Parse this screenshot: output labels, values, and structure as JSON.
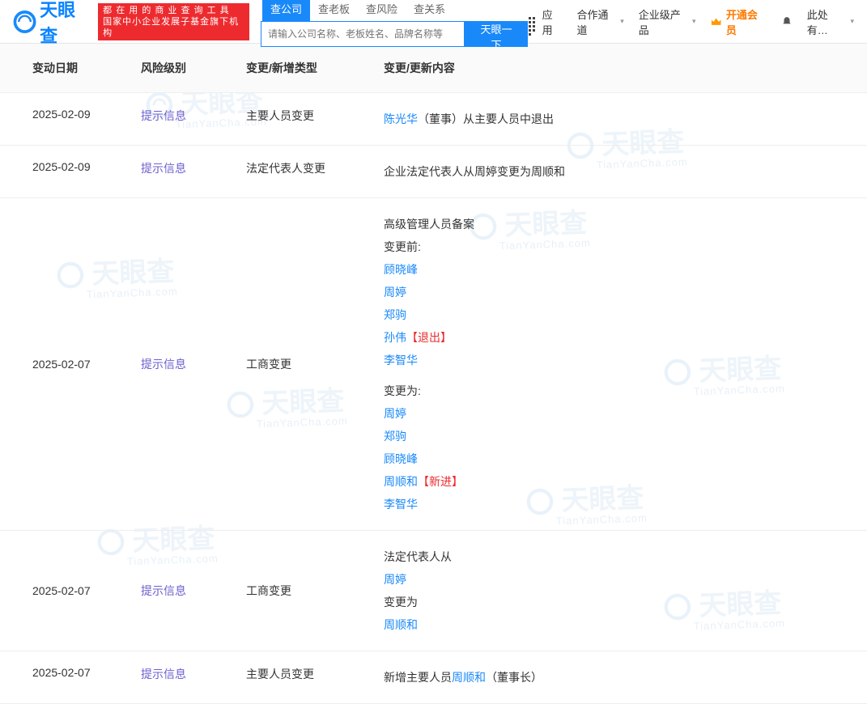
{
  "header": {
    "brand": "天眼查",
    "watermark_sub": "TianYanCha.com",
    "redbox_l1": "都 在 用 的 商 业 查 询 工 具",
    "redbox_l2": "国家中小企业发展子基金旗下机构",
    "tabs": [
      "查公司",
      "查老板",
      "查风险",
      "查关系"
    ],
    "search_placeholder": "请输入公司名称、老板姓名、品牌名称等",
    "search_btn": "天眼一下",
    "nav_app": "应用",
    "nav_channel": "合作通道",
    "nav_products": "企业级产品",
    "nav_vip": "开通会员",
    "nav_more": "此处有…"
  },
  "columns": {
    "date": "变动日期",
    "risk": "风险级别",
    "type": "变更/新增类型",
    "content": "变更/更新内容"
  },
  "labels": {
    "risk_hint": "提示信息",
    "before": "变更前:",
    "after": "变更为:",
    "after2": "变更为",
    "title_senior": "高级管理人员备案",
    "title_legal_from": "法定代表人从",
    "exit_tag": "【退出】",
    "new_tag": "【新进】"
  },
  "rows": [
    {
      "date": "2025-02-09",
      "type": "主要人员变更",
      "content_kind": "simple",
      "person": "陈光华",
      "suffix": "（董事）从主要人员中退出"
    },
    {
      "date": "2025-02-09",
      "type": "法定代表人变更",
      "content_kind": "plain",
      "text": "企业法定代表人从周婷变更为周顺和"
    },
    {
      "date": "2025-02-07",
      "type": "工商变更",
      "content_kind": "senior",
      "before": [
        {
          "name": "顾晓峰"
        },
        {
          "name": "周婷"
        },
        {
          "name": "郑驹"
        },
        {
          "name": "孙伟",
          "tag": "exit"
        },
        {
          "name": "李智华"
        }
      ],
      "after": [
        {
          "name": "周婷"
        },
        {
          "name": "郑驹"
        },
        {
          "name": "顾晓峰"
        },
        {
          "name": "周顺和",
          "tag": "new"
        },
        {
          "name": "李智华"
        }
      ]
    },
    {
      "date": "2025-02-07",
      "type": "工商变更",
      "content_kind": "legal",
      "from": "周婷",
      "to": "周顺和"
    },
    {
      "date": "2025-02-07",
      "type": "主要人员变更",
      "content_kind": "simple2",
      "prefix": "新增主要人员",
      "person": "周顺和",
      "suffix": "（董事长）"
    }
  ]
}
